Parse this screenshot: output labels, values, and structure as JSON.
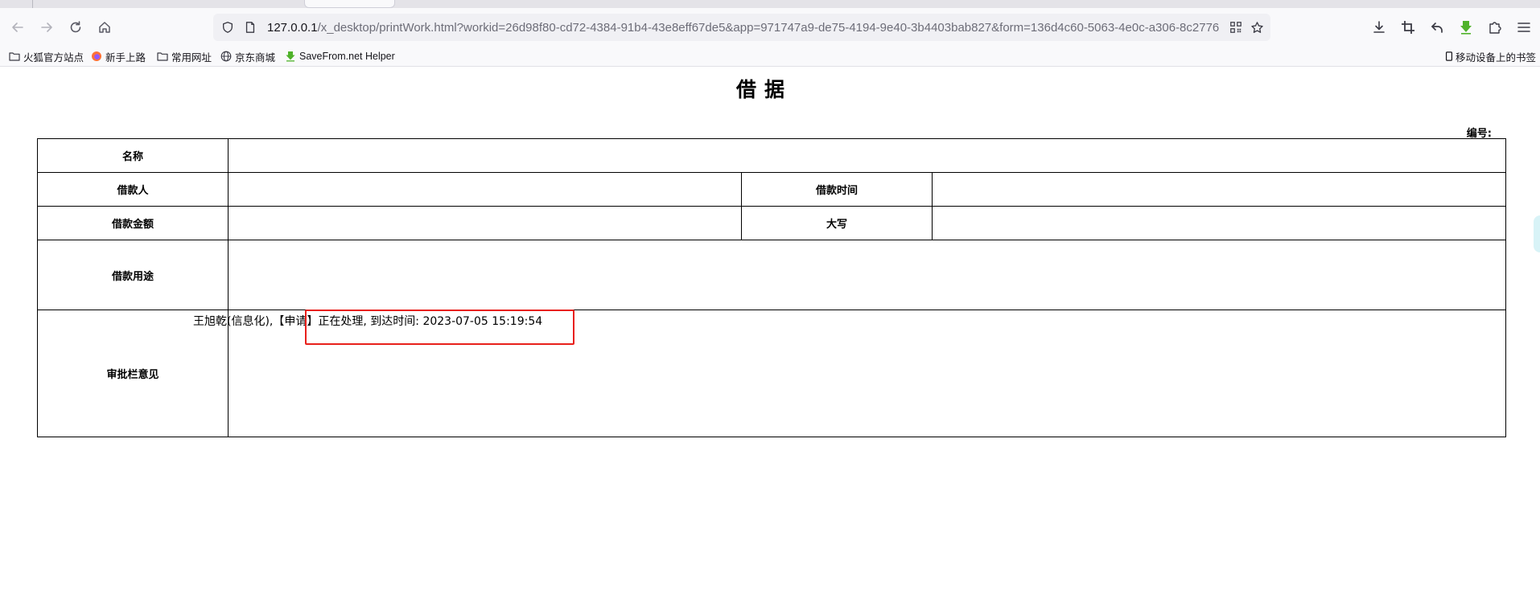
{
  "browser": {
    "url_host": "127.0.0.1",
    "url_rest": "/x_desktop/printWork.html?workid=26d98f80-cd72-4384-91b4-43e8eff67de5&app=971747a9-de75-4194-9e40-3b4403bab827&form=136d4c60-5063-4e0c-a306-8c2776",
    "bookmarks": [
      {
        "label": "火狐官方站点",
        "icon": "folder-icon"
      },
      {
        "label": "新手上路",
        "icon": "firefox-icon"
      },
      {
        "label": "常用网址",
        "icon": "folder-icon"
      },
      {
        "label": "京东商城",
        "icon": "globe-icon"
      },
      {
        "label": "SaveFrom.net Helper",
        "icon": "savefrom-arrow-icon"
      }
    ],
    "mobile_bookmarks": "移动设备上的书签"
  },
  "document": {
    "title": "借据",
    "number_label": "编号:",
    "rows": {
      "name_label": "名称",
      "borrower_label": "借款人",
      "borrow_time_label": "借款时间",
      "amount_label": "借款金额",
      "uppercase_label": "大写",
      "purpose_label": "借款用途",
      "approval_label": "审批栏意见"
    },
    "approval_entry": "王旭乾(信息化),【申请】正在处理, 到达时间: 2023-07-05 15:19:54"
  },
  "colors": {
    "highlight": "#e8201b",
    "chrome_bg": "#f9f9fb",
    "urlbar_bg": "#f0f0f4"
  }
}
